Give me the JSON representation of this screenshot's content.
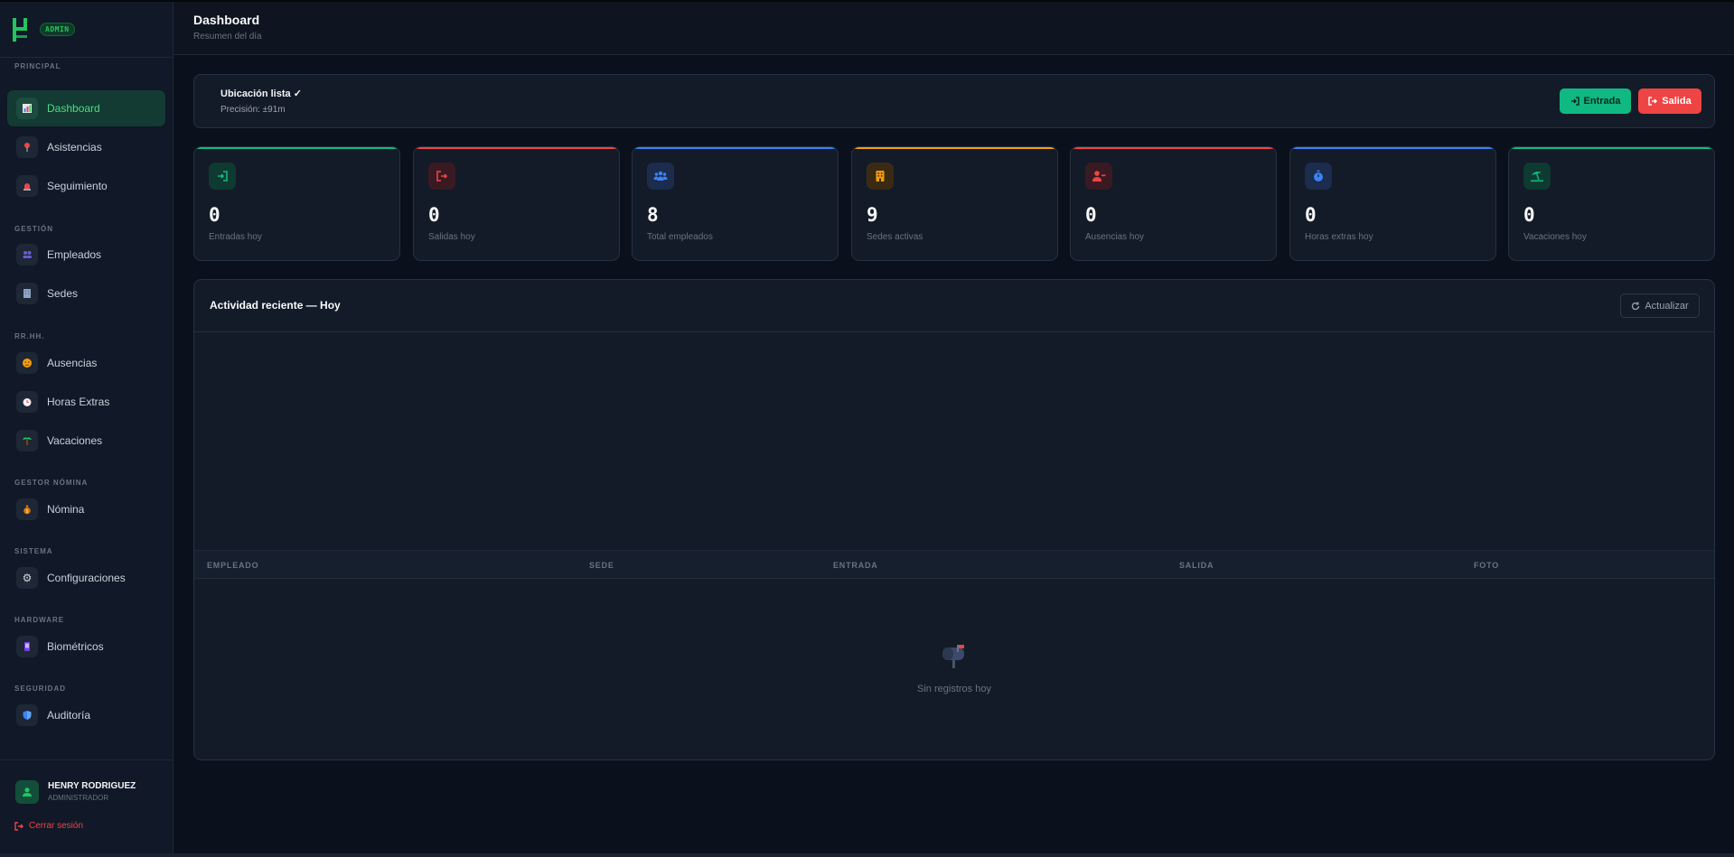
{
  "sidebar": {
    "badge": "ADMIN",
    "sections": {
      "principal": "PRINCIPAL",
      "gestion": "GESTIÓN",
      "rrhh": "RR.HH.",
      "nomina": "GESTOR NÓMINA",
      "sistema": "SISTEMA",
      "hardware": "HARDWARE",
      "seguridad": "SEGURIDAD"
    },
    "items": [
      {
        "label": "Dashboard",
        "icon": "chart-icon"
      },
      {
        "label": "Asistencias",
        "icon": "pin-icon"
      },
      {
        "label": "Seguimiento",
        "icon": "siren-icon"
      },
      {
        "label": "Empleados",
        "icon": "people-icon"
      },
      {
        "label": "Sedes",
        "icon": "building-icon"
      },
      {
        "label": "Ausencias",
        "icon": "face-icon"
      },
      {
        "label": "Horas Extras",
        "icon": "clock-icon"
      },
      {
        "label": "Vacaciones",
        "icon": "palm-icon"
      },
      {
        "label": "Nómina",
        "icon": "money-bag-icon"
      },
      {
        "label": "Configuraciones",
        "icon": "gear-icon"
      },
      {
        "label": "Biométricos",
        "icon": "device-icon"
      },
      {
        "label": "Auditoría",
        "icon": "shield-icon"
      }
    ],
    "user": {
      "name": "HENRY RODRIGUEZ",
      "role": "ADMINISTRADOR"
    },
    "logout": "Cerrar sesión"
  },
  "header": {
    "title": "Dashboard",
    "subtitle": "Resumen del día"
  },
  "location": {
    "title": "Ubicación lista ✓",
    "precision": "Precisión: ±91m",
    "entrada_label": "Entrada",
    "salida_label": "Salida"
  },
  "stats": [
    {
      "value": "0",
      "label": "Entradas hoy",
      "color": "#10b981"
    },
    {
      "value": "0",
      "label": "Salidas hoy",
      "color": "#ef4444"
    },
    {
      "value": "8",
      "label": "Total empleados",
      "color": "#3b82f6"
    },
    {
      "value": "9",
      "label": "Sedes activas",
      "color": "#f59e0b"
    },
    {
      "value": "0",
      "label": "Ausencias hoy",
      "color": "#ef4444"
    },
    {
      "value": "0",
      "label": "Horas extras hoy",
      "color": "#3b82f6"
    },
    {
      "value": "0",
      "label": "Vacaciones hoy",
      "color": "#10b981"
    }
  ],
  "activity": {
    "title": "Actividad reciente — Hoy",
    "refresh_label": "Actualizar",
    "columns": [
      "EMPLEADO",
      "SEDE",
      "ENTRADA",
      "SALIDA",
      "FOTO"
    ],
    "empty_text": "Sin registros hoy"
  }
}
